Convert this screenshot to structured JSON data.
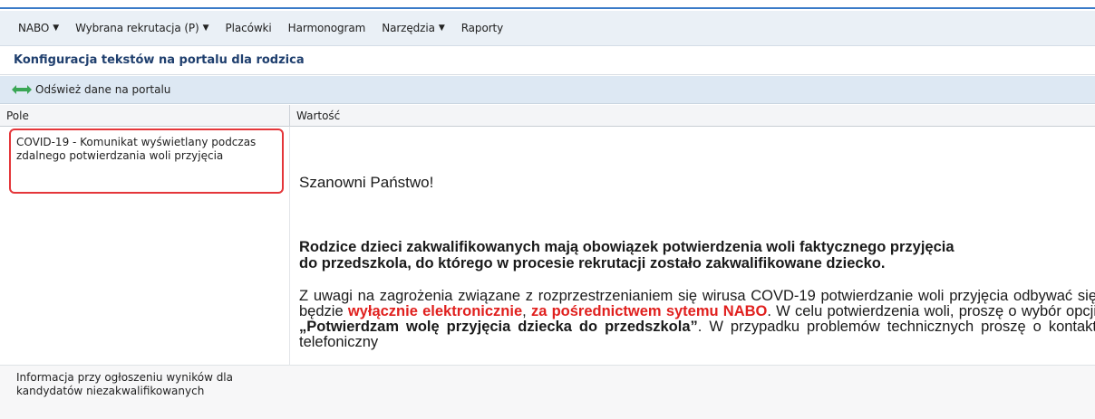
{
  "nav": {
    "items": [
      {
        "label": "NABO",
        "dropdown": true
      },
      {
        "label": "Wybrana rekrutacja (P)",
        "dropdown": true
      },
      {
        "label": "Placówki",
        "dropdown": false
      },
      {
        "label": "Harmonogram",
        "dropdown": false
      },
      {
        "label": "Narzędzia",
        "dropdown": true
      },
      {
        "label": "Raporty",
        "dropdown": false
      }
    ]
  },
  "page": {
    "title": "Konfiguracja tekstów na portalu dla rodzica"
  },
  "toolbar": {
    "refresh_label": "Odśwież dane na portalu",
    "refresh_icon": "double-arrow-icon"
  },
  "grid": {
    "columns": [
      "Pole",
      "Wartość"
    ],
    "rows": [
      {
        "pole": "COVID-19 - Komunikat wyświetlany podczas zdalnego potwierdzania woli przyjęcia",
        "value": {
          "greeting": "Szanowni Państwo!",
          "para1_line1": "Rodzice dzieci zakwalifikowanych mają obowiązek potwierdzenia woli faktycznego przyjęcia",
          "para1_line2a": "do przedszkola",
          "para1_line2b": ", do którego w procesie rekrutacji zostało zakwalifikowane dziecko.",
          "para2_part1": "Z uwagi na zagrożenia związane z rozprzestrzenianiem się wirusa COVD-19 potwierdzanie woli przyjęcia odbywać się będzie ",
          "para2_red1": "wyłącznie elektronicznie",
          "para2_part2": ", ",
          "para2_red2": "za pośrednictwem sytemu NABO",
          "para2_part3": ". W celu potwierdzenia woli, proszę o wybór opcji ",
          "para2_bold": "„Potwierdzam wolę przyjęcia dziecka do przedszkola”",
          "para2_part4": ". W przypadku problemów technicznych proszę o kontakt telefoniczny"
        }
      },
      {
        "pole": "Informacja przy ogłoszeniu wyników dla kandydatów niezakwalifikowanych",
        "value": ""
      }
    ]
  },
  "colors": {
    "accent_blue": "#3a7bc8",
    "title_color": "#1f3f6e",
    "highlight_red": "#e4363a",
    "text_red": "#e0201e",
    "refresh_icon_green": "#3aa655"
  }
}
